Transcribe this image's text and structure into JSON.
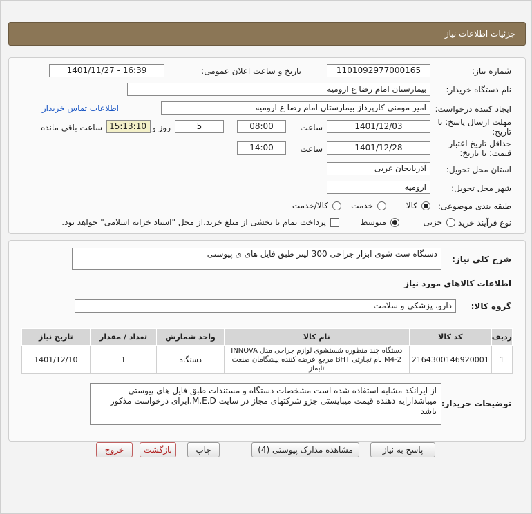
{
  "header": {
    "title": "جزئیات اطلاعات نیاز"
  },
  "form": {
    "need_number_label": "شماره نیاز:",
    "need_number": "1101092977000165",
    "announce_label": "تاریخ و ساعت اعلان عمومی:",
    "announce_value": "1401/11/27 - 16:39",
    "buyer_label": "نام دستگاه خریدار:",
    "buyer_value": "بیمارستان امام رضا  ع  ارومیه",
    "creator_label": "ایجاد کننده درخواست:",
    "creator_value": "امیر مومنی کارپرداز بیمارستان امام رضا  ع  ارومیه",
    "contact_link": "اطلاعات تماس خریدار",
    "deadline_label_1": "مهلت ارسال پاسخ: تا",
    "deadline_label_2": "تاریخ:",
    "deadline_date": "1401/12/03",
    "time_label": "ساعت",
    "deadline_time": "08:00",
    "days_value": "5",
    "days_label": "روز و",
    "remaining_time": "15:13:10",
    "remaining_label": "ساعت باقی مانده",
    "validity_label_1": "حداقل تاریخ اعتبار",
    "validity_label_2": "قیمت: تا تاریخ:",
    "validity_date": "1401/12/28",
    "validity_time_label": "ساعت",
    "validity_time": "14:00",
    "province_label": "استان محل تحویل:",
    "province_value": "آذربایجان غربی",
    "city_label": "شهر محل تحویل:",
    "city_value": "ارومیه",
    "category_label": "طبقه بندی موضوعی:",
    "category_options": [
      "کالا",
      "خدمت",
      "کالا/خدمت"
    ],
    "category_selected": "کالا",
    "process_label": "نوع فرآیند خرید :",
    "process_options": [
      "جزیی",
      "متوسط"
    ],
    "process_selected": "متوسط",
    "payment_note": "پرداخت تمام یا بخشی از مبلغ خرید،از محل \"اسناد خزانه اسلامی\" خواهد بود."
  },
  "details": {
    "summary_label": "شرح کلی نیاز:",
    "summary_value": "دستگاه ست شوی ابزار جراحی 300 لیتر طبق فایل های ی پیوستی",
    "goods_info_title": "اطلاعات کالاهای مورد نیاز",
    "goods_group_label": "گروه کالا:",
    "goods_group_value": "دارو، پزشکی و سلامت",
    "table": {
      "headers": [
        "ردیف",
        "کد کالا",
        "نام کالا",
        "واحد شمارش",
        "تعداد / مقدار",
        "تاریخ نیاز"
      ],
      "rows": [
        {
          "row": "1",
          "code": "2164300146920001",
          "name": "دستگاه چند منظوره شستشوی لوازم جراحی مدل INNOVA M4-2 نام تجارتی BHT مرجع عرضه کننده پیشگامان صنعت تابماز",
          "unit": "دستگاه",
          "qty": "1",
          "date": "1401/12/10"
        }
      ]
    },
    "buyer_notes_label": "توضیحات خریدار:",
    "buyer_notes_line1": "از ایرانکد مشابه استفاده شده است مشخصات دستگاه و مستندات طبق فایل های پیوستی",
    "buyer_notes_line2": "میباشدارایه دهنده قیمت میبایستی جزو شرکتهای مجاز در سایت I.M.E.Dبرای درخواست مذکور باشد"
  },
  "buttons": {
    "reply": "پاسخ به نیاز",
    "attachments": "مشاهده مدارک پیوستی (4)",
    "print": "چاپ",
    "back": "بازگشت",
    "exit": "خروج"
  }
}
